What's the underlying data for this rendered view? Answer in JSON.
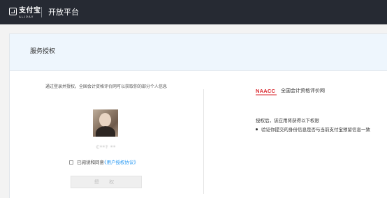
{
  "topbar": {
    "logo_cn": "支付宝",
    "logo_en": "ALIPAY",
    "title": "开放平台"
  },
  "auth": {
    "section_title": "服务授权",
    "intro": "通过登录并授权，全国会计资格评价网可以获取你的部分个人信息",
    "username": "C**? **",
    "agree_text": "已阅读和同意",
    "agree_link": "《用户授权协议》",
    "button_label": "授 权"
  },
  "org": {
    "logo_text": "NAACC",
    "name": "全国会计资格评价网",
    "permissions_title": "授权后，该应用将获得以下权限",
    "permissions": [
      "验证你提交的身份信息是否与当前支付宝预留信息一致"
    ]
  },
  "colors": {
    "topbar_bg": "#262a33",
    "link": "#2196f3",
    "header_bg": "#eef6fd",
    "naacc_red": "#d9262c"
  }
}
